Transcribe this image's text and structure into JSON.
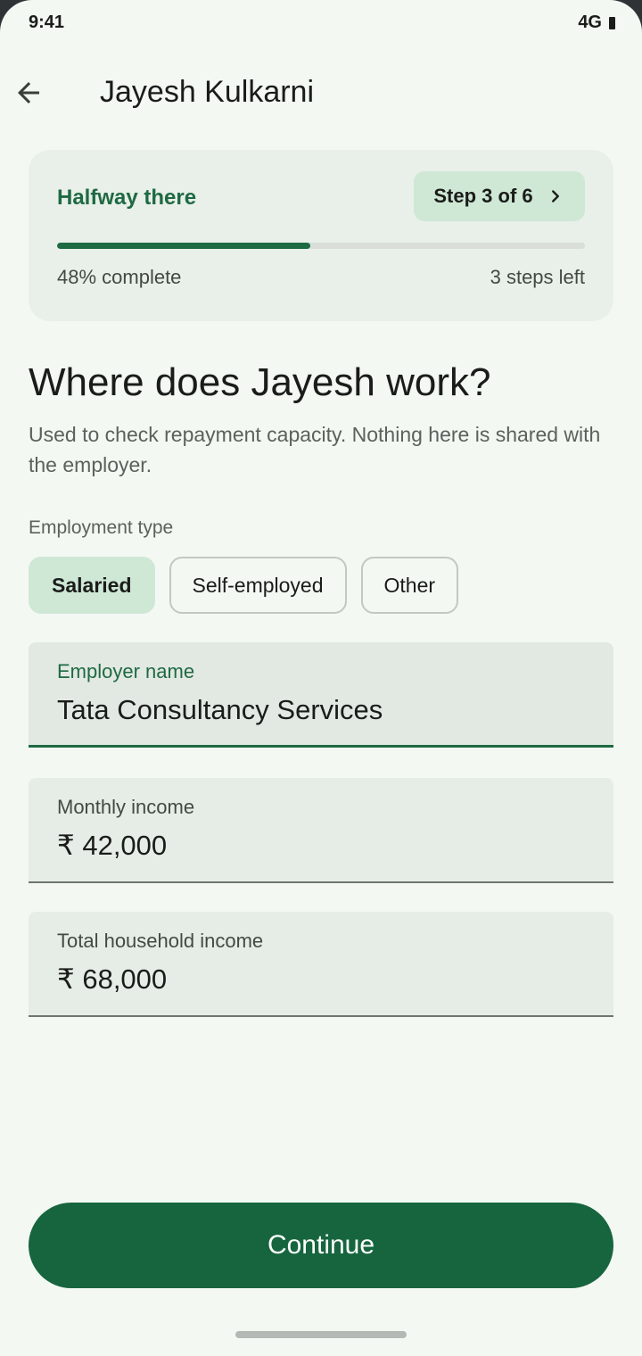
{
  "status_bar": {
    "time": "9:41",
    "network": "4G"
  },
  "app_bar": {
    "title": "Jayesh Kulkarni",
    "back_icon": "arrow-left-icon"
  },
  "progress": {
    "heading": "Halfway there",
    "step_label": "Step 3 of 6",
    "percent_label": "48% complete",
    "percent_value": 0.48,
    "steps_left_label": "3 steps left",
    "accent_color": "#1e6a42"
  },
  "question": {
    "title": "Where does Jayesh work?",
    "helper": "Used to check repayment capacity. Nothing here is shared with the employer."
  },
  "employment_type": {
    "label": "Employment type",
    "options": [
      "Salaried",
      "Self-employed",
      "Other"
    ],
    "selected": "Salaried"
  },
  "fields": {
    "employer": {
      "label": "Employer name",
      "value": "Tata Consultancy Services"
    },
    "monthly_income": {
      "label": "Monthly income",
      "value": "₹ 42,000"
    },
    "household_income": {
      "label": "Total household income",
      "value": "₹ 68,000"
    }
  },
  "continue_label": "Continue",
  "colors": {
    "primary": "#17653e",
    "background": "#f3f8f3",
    "chip_selected": "#cfe8d6"
  }
}
